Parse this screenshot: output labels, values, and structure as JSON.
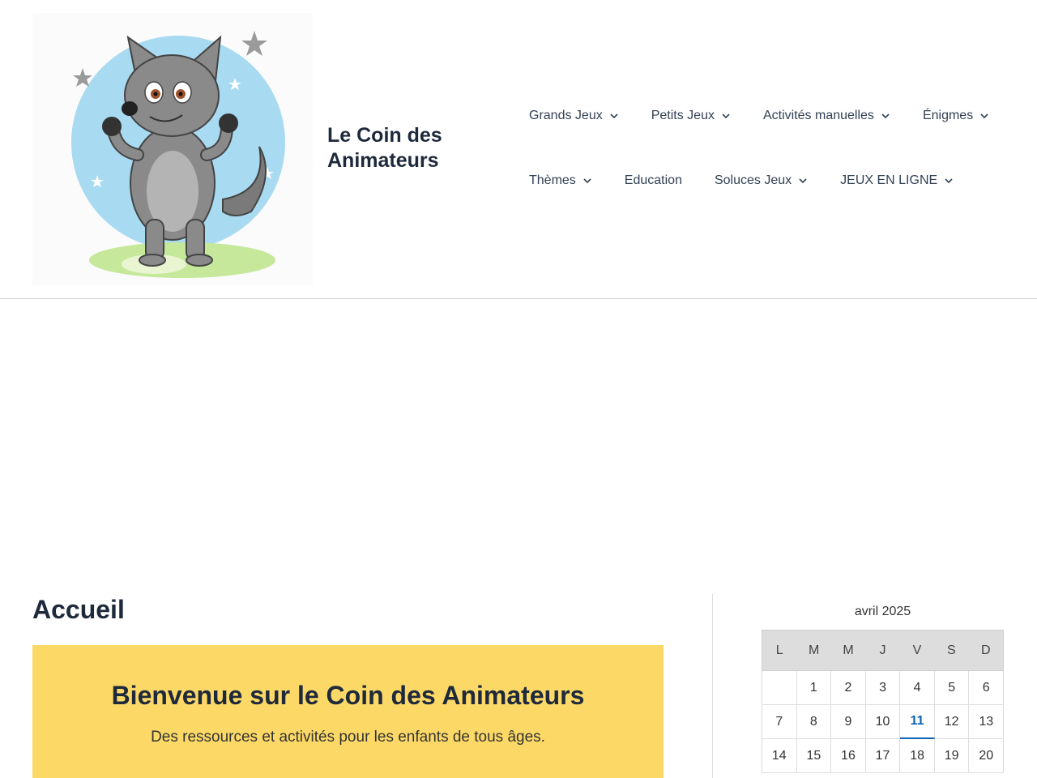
{
  "site": {
    "title": "Le Coin des Animateurs"
  },
  "nav": {
    "row1": [
      {
        "label": "Grands Jeux",
        "has_dropdown": true
      },
      {
        "label": "Petits Jeux",
        "has_dropdown": true
      },
      {
        "label": "Activités manuelles",
        "has_dropdown": true
      },
      {
        "label": "Énigmes",
        "has_dropdown": true
      }
    ],
    "row2": [
      {
        "label": "Thèmes",
        "has_dropdown": true
      },
      {
        "label": "Education",
        "has_dropdown": false
      },
      {
        "label": "Soluces Jeux",
        "has_dropdown": true
      },
      {
        "label": "JEUX EN LIGNE",
        "has_dropdown": true
      }
    ]
  },
  "page": {
    "title": "Accueil"
  },
  "welcome": {
    "heading": "Bienvenue sur le Coin des Animateurs",
    "subtext": "Des ressources et activités pour les enfants de tous âges.",
    "bg_color": "#fcd966"
  },
  "calendar": {
    "caption": "avril 2025",
    "weekdays": [
      "L",
      "M",
      "M",
      "J",
      "V",
      "S",
      "D"
    ],
    "weeks": [
      [
        "",
        "1",
        "2",
        "3",
        "4",
        "5",
        "6"
      ],
      [
        "7",
        "8",
        "9",
        "10",
        "11",
        "12",
        "13"
      ],
      [
        "14",
        "15",
        "16",
        "17",
        "18",
        "19",
        "20"
      ]
    ],
    "today": "11",
    "today_color": "#0b64b4"
  },
  "icons": {
    "logo": "wolf-mascot-logo",
    "dropdown": "chevron-down-icon"
  }
}
